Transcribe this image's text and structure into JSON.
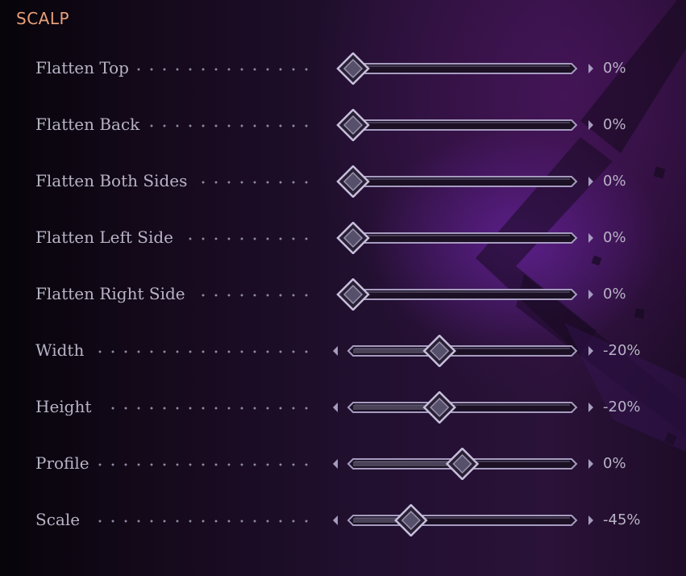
{
  "section": {
    "title": "SCALP"
  },
  "sliders": [
    {
      "label": "Flatten Top",
      "value": "0%",
      "level": 0,
      "left_arrow": false
    },
    {
      "label": "Flatten Back",
      "value": "0%",
      "level": 0,
      "left_arrow": false
    },
    {
      "label": "Flatten Both Sides",
      "value": "0%",
      "level": 0,
      "left_arrow": false
    },
    {
      "label": "Flatten Left Side",
      "value": "0%",
      "level": 0,
      "left_arrow": false
    },
    {
      "label": "Flatten Right Side",
      "value": "0%",
      "level": 0,
      "left_arrow": false
    },
    {
      "label": "Width",
      "value": "-20%",
      "level": 0.4,
      "left_arrow": true
    },
    {
      "label": "Height",
      "value": "-20%",
      "level": 0.4,
      "left_arrow": true
    },
    {
      "label": "Profile",
      "value": "0%",
      "level": 0.5,
      "left_arrow": true
    },
    {
      "label": "Scale",
      "value": "-45%",
      "level": 0.275,
      "left_arrow": true
    }
  ],
  "colors": {
    "title": "#e8a07a",
    "label": "#b8b4c6",
    "track_border": "#a69cc0",
    "knob": "#c6bedc",
    "arrow": "#a69cc0"
  },
  "icons": {
    "knob": "diamond-knob-icon",
    "left": "arrow-left-icon",
    "right": "arrow-right-icon"
  }
}
